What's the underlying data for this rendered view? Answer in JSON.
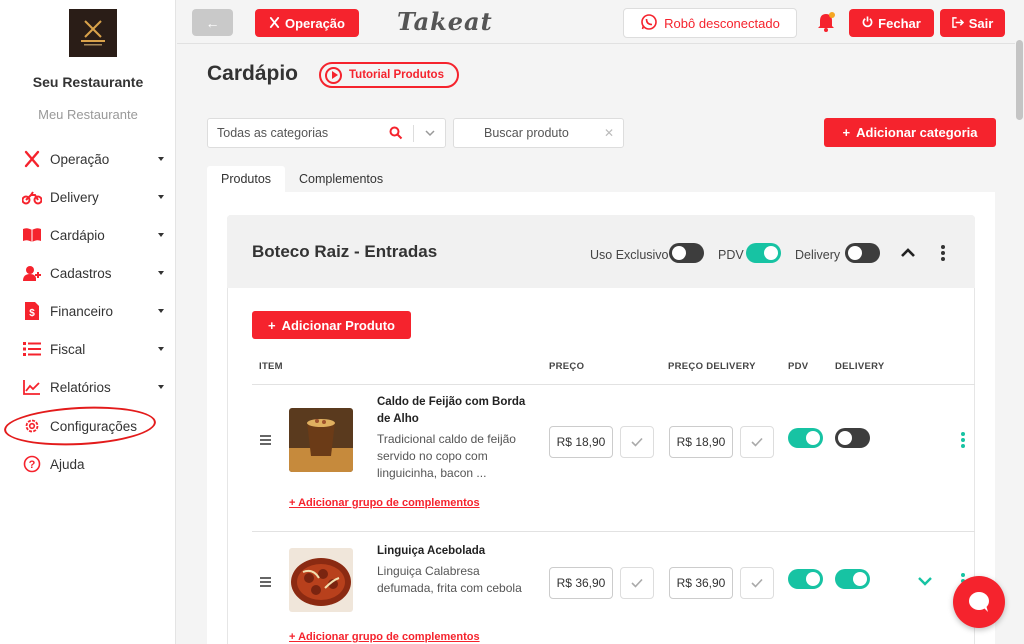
{
  "sidebar": {
    "restaurant_name": "Seu Restaurante",
    "restaurant_sub": "Meu Restaurante",
    "items": [
      {
        "label": "Operação",
        "icon": "utensils-icon"
      },
      {
        "label": "Delivery",
        "icon": "motorcycle-icon"
      },
      {
        "label": "Cardápio",
        "icon": "book-icon"
      },
      {
        "label": "Cadastros",
        "icon": "user-plus-icon"
      },
      {
        "label": "Financeiro",
        "icon": "invoice-icon"
      },
      {
        "label": "Fiscal",
        "icon": "list-icon"
      },
      {
        "label": "Relatórios",
        "icon": "line-chart-icon"
      },
      {
        "label": "Configurações",
        "icon": "gear-icon"
      },
      {
        "label": "Ajuda",
        "icon": "question-icon"
      }
    ]
  },
  "topbar": {
    "back_label": "←",
    "operacao_label": "Operação",
    "brand": "Takeat",
    "robot_status": "Robô desconectado",
    "fechar_label": "Fechar",
    "sair_label": "Sair"
  },
  "main": {
    "title": "Cardápio",
    "tutorial_label": "Tutorial Produtos",
    "category_select": "Todas as categorias",
    "search_placeholder": "Buscar produto",
    "add_category_label": "Adicionar categoria",
    "tabs": [
      {
        "label": "Produtos",
        "active": true
      },
      {
        "label": "Complementos",
        "active": false
      }
    ]
  },
  "category": {
    "title": "Boteco Raiz - Entradas",
    "toggles": [
      {
        "label": "Uso Exclusivo",
        "on": false
      },
      {
        "label": "PDV",
        "on": true
      },
      {
        "label": "Delivery",
        "on": false
      }
    ],
    "add_product_label": "Adicionar Produto",
    "columns": [
      "ITEM",
      "PREÇO",
      "PREÇO DELIVERY",
      "PDV",
      "DELIVERY"
    ],
    "add_group_label": "+ Adicionar grupo de complementos",
    "products": [
      {
        "name": "Caldo de Feijão com Borda de Alho",
        "description": "Tradicional caldo de feijão servido no copo com linguicinha, bacon ...",
        "price": "R$ 18,90",
        "price_delivery": "R$ 18,90",
        "pdv": true,
        "delivery": false
      },
      {
        "name": "Linguiça Acebolada",
        "description": "Linguiça Calabresa defumada, frita com cebola",
        "price": "R$ 36,90",
        "price_delivery": "R$ 36,90",
        "pdv": true,
        "delivery": true
      }
    ]
  },
  "colors": {
    "accent": "#f5232d",
    "toggle_on": "#17c3a3",
    "toggle_off": "#3d3d3d"
  }
}
